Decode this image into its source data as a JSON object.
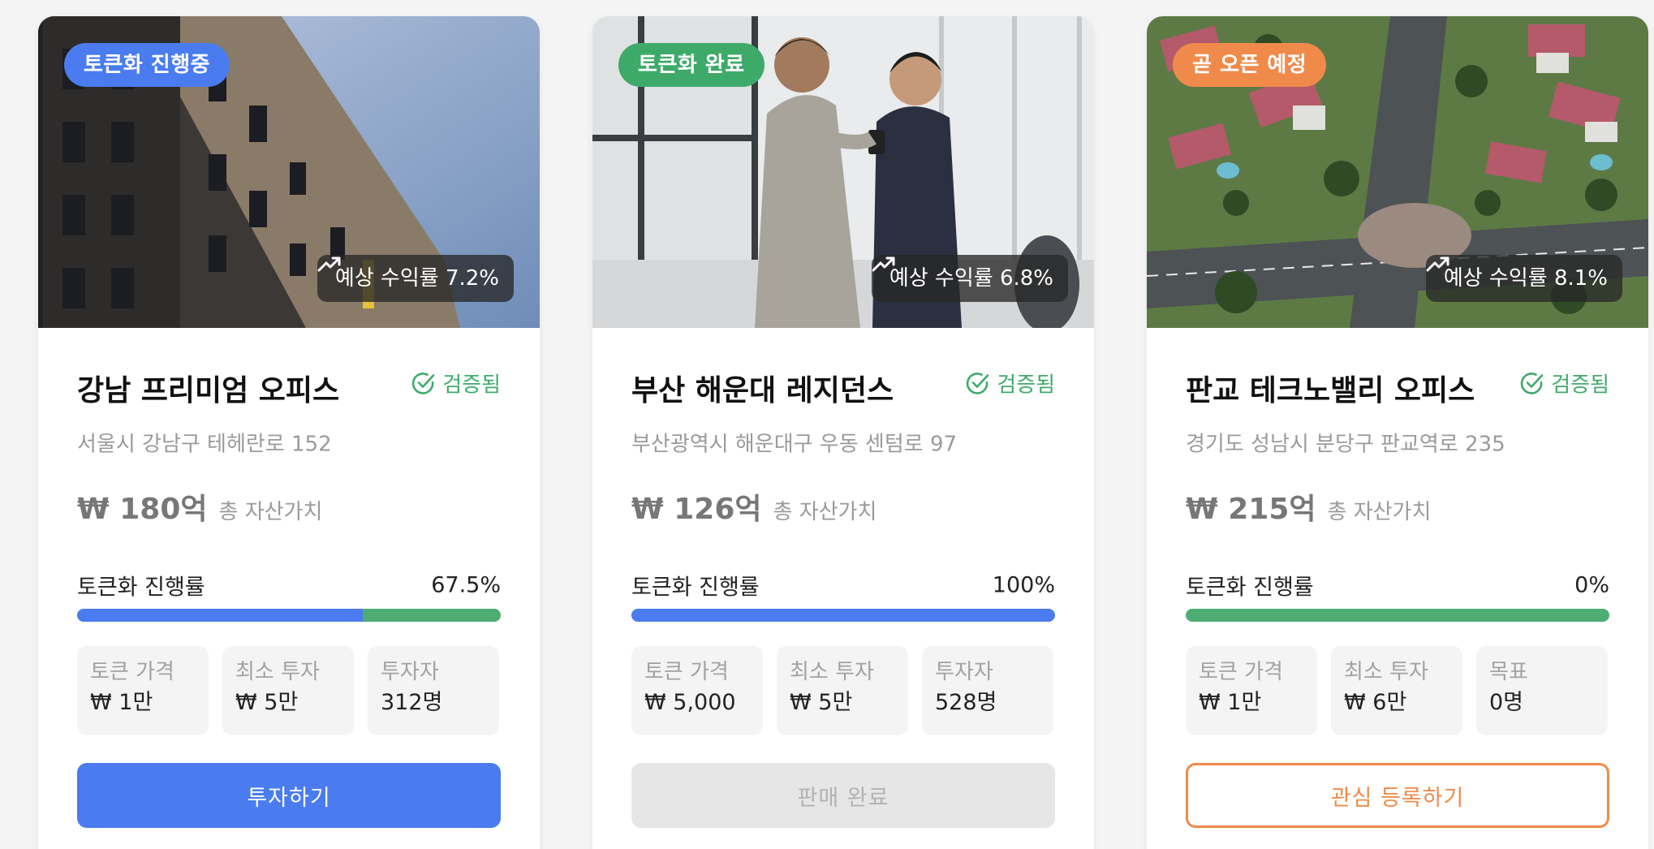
{
  "colors": {
    "blue": "#4a7cef",
    "green": "#3eaa6a",
    "orange": "#f08a4b",
    "track_green": "#4ead72"
  },
  "cards": [
    {
      "status": "토큰화 진행중",
      "status_color": "#4a7cef",
      "yield": "예상 수익률 7.2%",
      "title": "강남 프리미엄 오피스",
      "verified": "검증됨",
      "address": "서울시 강남구 테헤란로 152",
      "value": "₩ 180억",
      "value_label": "총 자산가치",
      "progress_label": "토큰화 진행률",
      "progress_pct": "67.5%",
      "progress": 0.675,
      "stats": [
        {
          "label": "토큰 가격",
          "value": "₩ 1만"
        },
        {
          "label": "최소 투자",
          "value": "₩ 5만"
        },
        {
          "label": "투자자",
          "value": "312명"
        }
      ],
      "button": "투자하기",
      "image_icon": "building-photo"
    },
    {
      "status": "토큰화 완료",
      "status_color": "#3eaa6a",
      "yield": "예상 수익률 6.8%",
      "title": "부산 해운대 레지던스",
      "verified": "검증됨",
      "address": "부산광역시 해운대구 우동 센텀로 97",
      "value": "₩ 126억",
      "value_label": "총 자산가치",
      "progress_label": "토큰화 진행률",
      "progress_pct": "100%",
      "progress": 1.0,
      "stats": [
        {
          "label": "토큰 가격",
          "value": "₩ 5,000"
        },
        {
          "label": "최소 투자",
          "value": "₩ 5만"
        },
        {
          "label": "투자자",
          "value": "528명"
        }
      ],
      "button": "판매 완료",
      "image_icon": "business-people-photo"
    },
    {
      "status": "곧 오픈 예정",
      "status_color": "#f08a4b",
      "yield": "예상 수익률 8.1%",
      "title": "판교 테크노밸리 오피스",
      "verified": "검증됨",
      "address": "경기도 성남시 분당구 판교역로 235",
      "value": "₩ 215억",
      "value_label": "총 자산가치",
      "progress_label": "토큰화 진행률",
      "progress_pct": "0%",
      "progress": 0.0,
      "stats": [
        {
          "label": "토큰 가격",
          "value": "₩ 1만"
        },
        {
          "label": "최소 투자",
          "value": "₩ 6만"
        },
        {
          "label": "목표",
          "value": "0명"
        }
      ],
      "button": "관심 등록하기",
      "image_icon": "aerial-neighborhood-photo"
    }
  ]
}
